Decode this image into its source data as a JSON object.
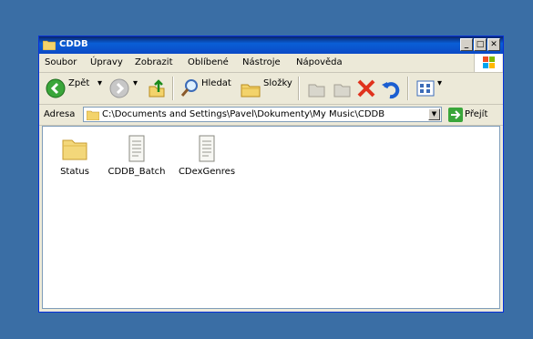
{
  "window": {
    "title": "CDDB"
  },
  "menu": [
    "Soubor",
    "Úpravy",
    "Zobrazit",
    "Oblíbené",
    "Nástroje",
    "Nápověda"
  ],
  "toolbar": {
    "back_label": "Zpět",
    "search_label": "Hledat",
    "folders_label": "Složky"
  },
  "address": {
    "label": "Adresa",
    "path": "C:\\Documents and Settings\\Pavel\\Dokumenty\\My Music\\CDDB",
    "go_label": "Přejít"
  },
  "files": [
    {
      "name": "Status",
      "type": "folder"
    },
    {
      "name": "CDDB_Batch",
      "type": "document"
    },
    {
      "name": "CDexGenres",
      "type": "document"
    }
  ],
  "colors": {
    "desktop": "#3a6ea5",
    "titlebar": "#0a5fd6",
    "window_face": "#ece9d8"
  }
}
